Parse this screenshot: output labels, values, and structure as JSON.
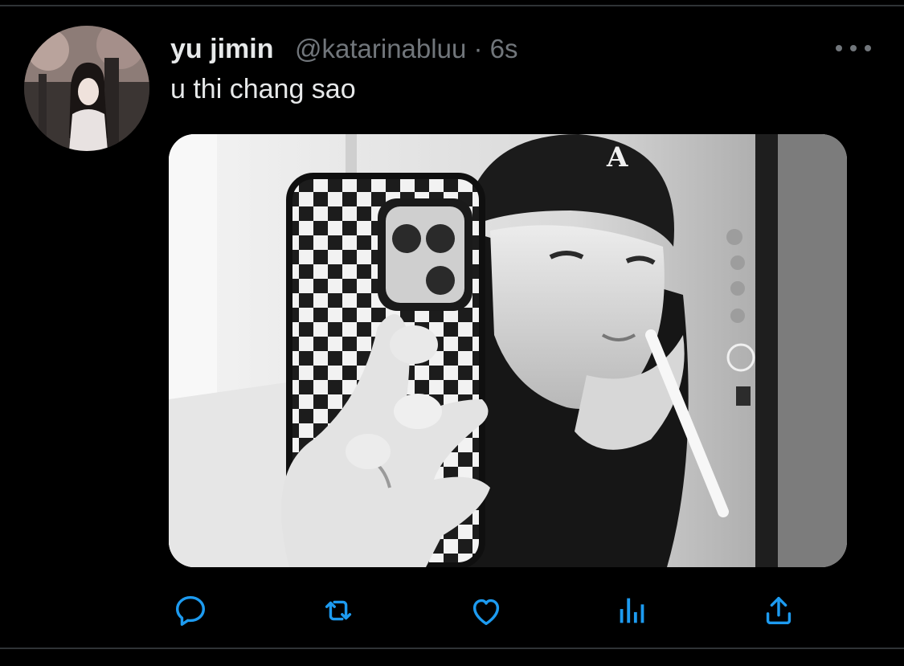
{
  "tweet": {
    "name": "yu jimin",
    "meta": "@katarinabluu · 6s",
    "text": "u thi chang sao"
  },
  "actions": {
    "reply": "reply-icon",
    "retweet": "retweet-icon",
    "like": "heart-icon",
    "analytics": "analytics-icon",
    "share": "share-icon"
  },
  "colors": {
    "background": "#000000",
    "primary_text": "#e7e9ea",
    "secondary_text": "#71767b",
    "action_icon": "#1d9bf0",
    "divider": "#2f3336"
  }
}
